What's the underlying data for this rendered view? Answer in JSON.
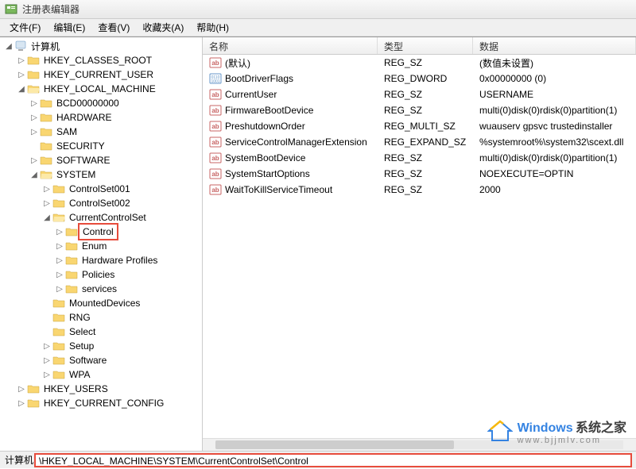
{
  "window": {
    "title": "注册表编辑器"
  },
  "menu": {
    "file": "文件(F)",
    "edit": "编辑(E)",
    "view": "查看(V)",
    "favorites": "收藏夹(A)",
    "help": "帮助(H)"
  },
  "tree": {
    "root": "计算机",
    "hkcr": "HKEY_CLASSES_ROOT",
    "hkcu": "HKEY_CURRENT_USER",
    "hklm": "HKEY_LOCAL_MACHINE",
    "bcd": "BCD00000000",
    "hardware": "HARDWARE",
    "sam": "SAM",
    "security": "SECURITY",
    "software": "SOFTWARE",
    "system": "SYSTEM",
    "cs001": "ControlSet001",
    "cs002": "ControlSet002",
    "ccs": "CurrentControlSet",
    "control": "Control",
    "enum": "Enum",
    "hwprofiles": "Hardware Profiles",
    "policies": "Policies",
    "services": "services",
    "mounted": "MountedDevices",
    "rng": "RNG",
    "select": "Select",
    "setup": "Setup",
    "software2": "Software",
    "wpa": "WPA",
    "hku": "HKEY_USERS",
    "hkcc": "HKEY_CURRENT_CONFIG"
  },
  "columns": {
    "name": "名称",
    "type": "类型",
    "data": "数据"
  },
  "values": [
    {
      "icon": "string",
      "name": "(默认)",
      "type": "REG_SZ",
      "data": "(数值未设置)"
    },
    {
      "icon": "binary",
      "name": "BootDriverFlags",
      "type": "REG_DWORD",
      "data": "0x00000000 (0)"
    },
    {
      "icon": "string",
      "name": "CurrentUser",
      "type": "REG_SZ",
      "data": "USERNAME"
    },
    {
      "icon": "string",
      "name": "FirmwareBootDevice",
      "type": "REG_SZ",
      "data": "multi(0)disk(0)rdisk(0)partition(1)"
    },
    {
      "icon": "string",
      "name": "PreshutdownOrder",
      "type": "REG_MULTI_SZ",
      "data": "wuauserv gpsvc trustedinstaller"
    },
    {
      "icon": "string",
      "name": "ServiceControlManagerExtension",
      "type": "REG_EXPAND_SZ",
      "data": "%systemroot%\\system32\\scext.dll"
    },
    {
      "icon": "string",
      "name": "SystemBootDevice",
      "type": "REG_SZ",
      "data": "multi(0)disk(0)rdisk(0)partition(1)"
    },
    {
      "icon": "string",
      "name": "SystemStartOptions",
      "type": "REG_SZ",
      "data": " NOEXECUTE=OPTIN"
    },
    {
      "icon": "string",
      "name": "WaitToKillServiceTimeout",
      "type": "REG_SZ",
      "data": "2000"
    }
  ],
  "status": {
    "label": "计算机",
    "path": "\\HKEY_LOCAL_MACHINE\\SYSTEM\\CurrentControlSet\\Control"
  },
  "watermark": {
    "brand": "Windows",
    "tagline": "系统之家",
    "url": "www.bjjmlv.com"
  }
}
